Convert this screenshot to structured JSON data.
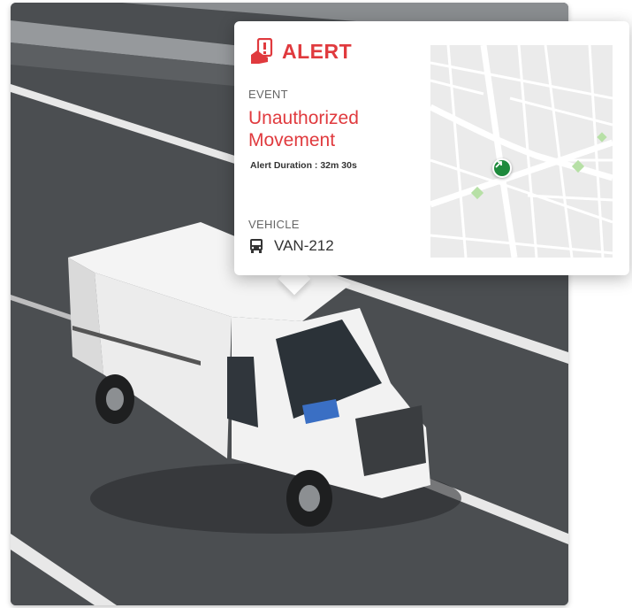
{
  "alert": {
    "title": "ALERT",
    "icon": "alert-hand-icon",
    "accent_color": "#e03a3e"
  },
  "event": {
    "label": "EVENT",
    "value": "Unauthorized Movement",
    "duration": "Alert Duration : 32m 30s"
  },
  "vehicle": {
    "label": "VEHICLE",
    "icon": "bus-icon",
    "name": "VAN-212"
  },
  "map": {
    "marker_icon": "navigation-arrow-icon",
    "marker_color": "#1e8a3c"
  }
}
